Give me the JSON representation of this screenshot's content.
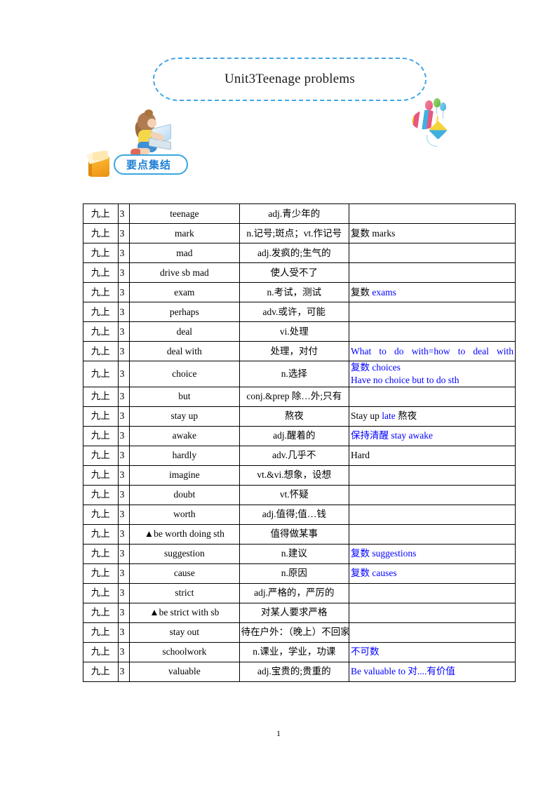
{
  "header": {
    "title": "Unit3Teenage problems",
    "girl_icon": "girl-with-laptop-icon",
    "balloon_icon": "hot-air-balloon-kite-icon"
  },
  "section": {
    "label": "要点集结",
    "book_icon": "open-book-icon",
    "accent_color": "#36A8E0",
    "text_color": "#1C7FD4"
  },
  "table": {
    "blue_color": "#0000FF",
    "rows": [
      {
        "grade": "九上",
        "unit": "3",
        "word": "teenage",
        "word_color": "black",
        "meaning": "adj.青少年的",
        "meaning_align": "center",
        "note_segments": []
      },
      {
        "grade": "九上",
        "unit": "3",
        "word": "mark",
        "word_color": "black",
        "meaning": "n.记号;斑点；vt.作记号",
        "meaning_align": "center",
        "note_segments": [
          {
            "text": "复数 marks",
            "color": "black"
          }
        ]
      },
      {
        "grade": "九上",
        "unit": "3",
        "word": "mad",
        "word_color": "black",
        "meaning": "adj.发疯的;生气的",
        "meaning_align": "center",
        "note_segments": []
      },
      {
        "grade": "九上",
        "unit": "3",
        "word": "drive sb mad",
        "word_color": "blue",
        "meaning": "使人受不了",
        "meaning_align": "center",
        "note_segments": []
      },
      {
        "grade": "九上",
        "unit": "3",
        "word": "exam",
        "word_color": "black",
        "meaning": "n.考试，测试",
        "meaning_align": "center",
        "note_segments": [
          {
            "text": "复数 ",
            "color": "black"
          },
          {
            "text": "exams",
            "color": "blue"
          }
        ]
      },
      {
        "grade": "九上",
        "unit": "3",
        "word": "perhaps",
        "word_color": "black",
        "meaning": "adv.或许，可能",
        "meaning_align": "center",
        "note_segments": []
      },
      {
        "grade": "九上",
        "unit": "3",
        "word": "deal",
        "word_color": "black",
        "meaning": "vi.处理",
        "meaning_align": "center",
        "note_segments": []
      },
      {
        "grade": "九上",
        "unit": "3",
        "word": "deal with",
        "word_color": "black",
        "meaning": "处理，对付",
        "meaning_align": "center",
        "note_justified": true,
        "note_segments": [
          {
            "text": "What to do with=how to deal with",
            "color": "blue"
          }
        ]
      },
      {
        "grade": "九上",
        "unit": "3",
        "word": "choice",
        "word_color": "black",
        "meaning": "n.选择",
        "meaning_align": "center",
        "note_lines": [
          [
            {
              "text": "复数 choices",
              "color": "blue"
            }
          ],
          [
            {
              "text": "Have no choice but to do sth",
              "color": "blue"
            }
          ]
        ]
      },
      {
        "grade": "九上",
        "unit": "3",
        "word": "but",
        "word_color": "black",
        "meaning": "conj.&prep 除…外;只有",
        "meaning_align": "center",
        "note_segments": []
      },
      {
        "grade": "九上",
        "unit": "3",
        "word": "stay up",
        "word_color": "blue",
        "meaning": "熬夜",
        "meaning_align": "center",
        "note_segments": [
          {
            "text": "Stay up ",
            "color": "black"
          },
          {
            "text": "late",
            "color": "blue"
          },
          {
            "text": " 熬夜",
            "color": "black"
          }
        ]
      },
      {
        "grade": "九上",
        "unit": "3",
        "word": "awake",
        "word_color": "black",
        "meaning": "adj.醒着的",
        "meaning_align": "center",
        "note_segments": [
          {
            "text": "保持清醒 stay awake",
            "color": "blue"
          }
        ]
      },
      {
        "grade": "九上",
        "unit": "3",
        "word": "hardly",
        "word_color": "blue",
        "meaning": "adv.几乎不",
        "meaning_align": "center",
        "note_segments": [
          {
            "text": "Hard",
            "color": "black"
          }
        ]
      },
      {
        "grade": "九上",
        "unit": "3",
        "word": "imagine",
        "word_color": "black",
        "meaning": "vt.&vi.想象，设想",
        "meaning_align": "center",
        "note_segments": []
      },
      {
        "grade": "九上",
        "unit": "3",
        "word": "doubt",
        "word_color": "black",
        "meaning": "vt.怀疑",
        "meaning_align": "center",
        "note_segments": []
      },
      {
        "grade": "九上",
        "unit": "3",
        "word": "worth",
        "word_color": "black",
        "meaning": "adj.值得;值…钱",
        "meaning_align": "center",
        "note_segments": []
      },
      {
        "grade": "九上",
        "unit": "3",
        "word": "▲be worth doing sth",
        "word_color": "blue",
        "meaning": "值得做某事",
        "meaning_align": "center",
        "note_segments": []
      },
      {
        "grade": "九上",
        "unit": "3",
        "word": "suggestion",
        "word_color": "black",
        "meaning": "n.建议",
        "meaning_align": "center",
        "note_segments": [
          {
            "text": "复数 suggestions",
            "color": "blue"
          }
        ]
      },
      {
        "grade": "九上",
        "unit": "3",
        "word": "cause",
        "word_color": "black",
        "meaning": "n.原因",
        "meaning_align": "center",
        "note_segments": [
          {
            "text": "复数 causes",
            "color": "blue"
          }
        ]
      },
      {
        "grade": "九上",
        "unit": "3",
        "word": "strict",
        "word_color": "black",
        "meaning": "adj.严格的，严厉的",
        "meaning_align": "center",
        "note_segments": []
      },
      {
        "grade": "九上",
        "unit": "3",
        "word": "▲be strict with sb",
        "word_color": "blue",
        "meaning": "对某人要求严格",
        "meaning_align": "center",
        "note_segments": []
      },
      {
        "grade": "九上",
        "unit": "3",
        "word": "stay out",
        "word_color": "black",
        "meaning": "待在户外：（晚上）不回家",
        "meaning_align": "left",
        "note_segments": []
      },
      {
        "grade": "九上",
        "unit": "3",
        "word": "schoolwork",
        "word_color": "black",
        "meaning": "n.课业，学业，功课",
        "meaning_align": "center",
        "note_segments": [
          {
            "text": "不可数",
            "color": "blue"
          }
        ]
      },
      {
        "grade": "九上",
        "unit": "3",
        "word": "valuable",
        "word_color": "black",
        "meaning": "adj.宝贵的;贵重的",
        "meaning_align": "center",
        "note_segments": [
          {
            "text": "Be valuable to  对....有价值",
            "color": "blue"
          }
        ]
      }
    ]
  },
  "footer": {
    "page_number": "1"
  }
}
